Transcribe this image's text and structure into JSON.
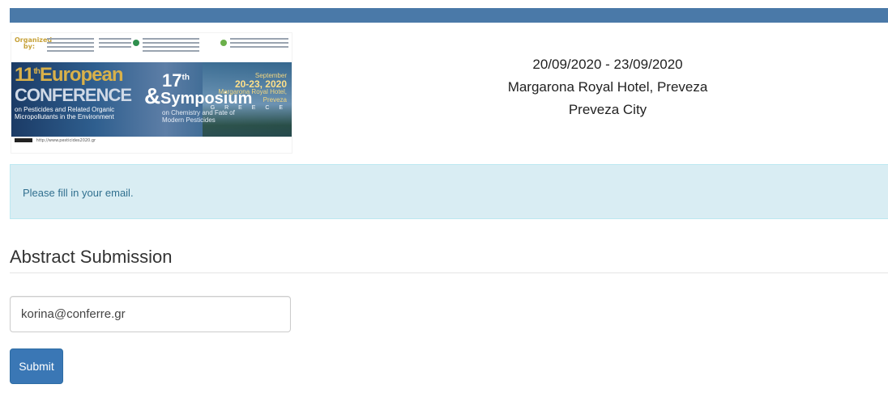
{
  "banner": {
    "organized_by": "Organized by:",
    "conference_number": "11",
    "conference_ordinal": "th",
    "conference_word1": "European",
    "conference_word2": "CONFERENCE",
    "conference_sub": "on Pesticides and Related Organic Micropollutants in the Environment",
    "ampersand": "&",
    "symposium_number": "17",
    "symposium_ordinal": "th",
    "symposium_word": "Symposium",
    "symposium_sub": "on Chemistry and Fate of Modern Pesticides",
    "month": "September",
    "days": "20-23, 2020",
    "venue_line": "Margarona Royal Hotel,",
    "venue_city": "Preveza",
    "country": "G R E E C E",
    "website": "http://www.pesticides2020.gr"
  },
  "event": {
    "dates": "20/09/2020 - 23/09/2020",
    "venue": "Margarona Royal Hotel, Preveza",
    "city": "Preveza City"
  },
  "alert": {
    "message": "Please fill in your email."
  },
  "form": {
    "title": "Abstract Submission",
    "email_value": "korina@conferre.gr",
    "submit_label": "Submit"
  },
  "colors": {
    "top_bar": "#4a79a8",
    "alert_bg": "#d9edf3",
    "alert_text": "#31708f",
    "button": "#3a77b5"
  }
}
